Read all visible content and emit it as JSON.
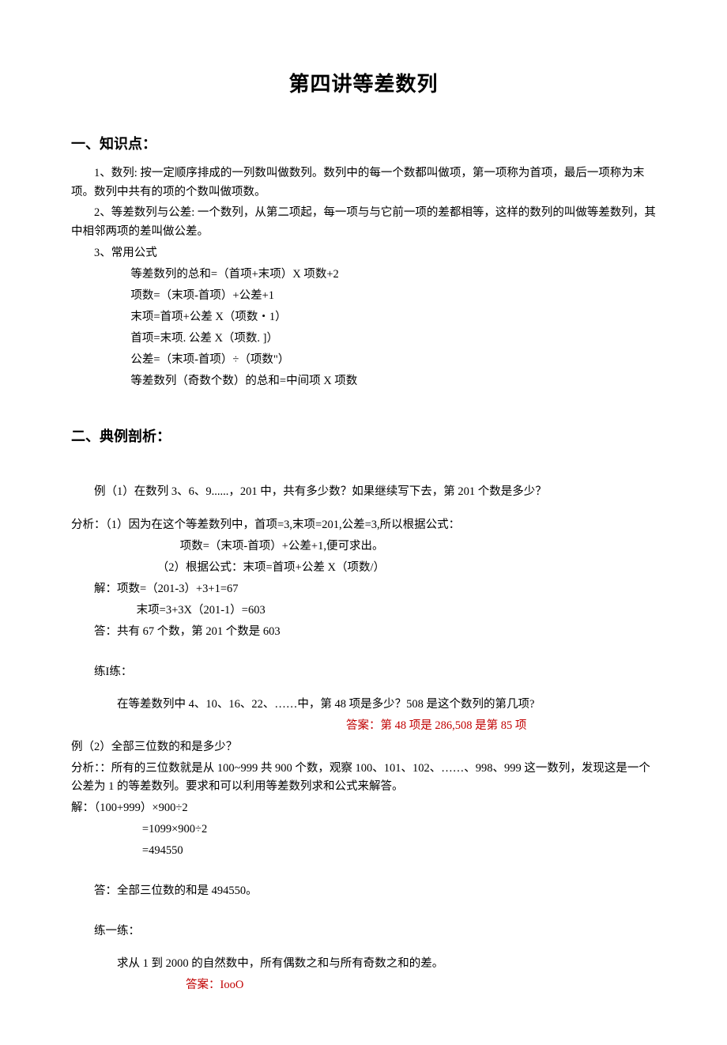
{
  "title": "第四讲等差数列",
  "s1": {
    "head": "一、知识点：",
    "p1": "1、数列: 按一定顺序排成的一列数叫做数列。数列中的每一个数都叫做项，第一项称为首项，最后一项称为末项。数列中共有的项的个数叫做项数。",
    "p2": "2、等差数列与公差: 一个数列，从第二项起，每一项与与它前一项的差都相等，这样的数列的叫做等差数列，其中相邻两项的差叫做公差。",
    "p3": "3、常用公式",
    "f1": "等差数列的总和=（首项+末项）X 项数+2",
    "f2": "项数=（末项-首项）+公差+1",
    "f3": "末项=首项+公差 X（项数・1）",
    "f4": "首项=末项. 公差 X（项数. ]）",
    "f5": "公差=（末项-首项）÷（项数\"）",
    "f6": "等差数列（奇数个数）的总和=中间项 X 项数"
  },
  "s2": {
    "head": "二、典例剖析：",
    "ex1_q": "例（1）在数列 3、6、9......，201 中，共有多少数？如果继续写下去，第 201 个数是多少？",
    "ex1_a1": "分析：（1）因为在这个等差数列中，首项=3,末项=201,公差=3,所以根据公式：",
    "ex1_a2": "项数=（末项-首项）+公差+1,便可求出。",
    "ex1_a3": "（2）根据公式：末项=首项+公差 X（项数/）",
    "ex1_s1": "解：项数=（201-3）+3+1=67",
    "ex1_s2": "末项=3+3X（201-1）=603",
    "ex1_s3": "答：共有 67 个数，第 201 个数是 603",
    "prac1_h": "练I练：",
    "prac1_q": "在等差数列中 4、10、16、22、……中，第 48 项是多少？508 是这个数列的第几项?",
    "prac1_ans": "答案：第 48 项是 286,508 是第 85 项",
    "ex2_q": "例（2）全部三位数的和是多少？",
    "ex2_a1": "分析：：所有的三位数就是从 100~999 共 900 个数，观察 100、101、102、……、998、999 这一数列，发现这是一个公差为 1 的等差数列。要求和可以利用等差数列求和公式来解答。",
    "ex2_s1": "解：（100+999）×900÷2",
    "ex2_s2": "=1099×900÷2",
    "ex2_s3": "=494550",
    "ex2_s4": "答：全部三位数的和是 494550。",
    "prac2_h": "练一练：",
    "prac2_q": "求从 1 到 2000 的自然数中，所有偶数之和与所有奇数之和的差。",
    "prac2_ans": "答案：IooO"
  }
}
